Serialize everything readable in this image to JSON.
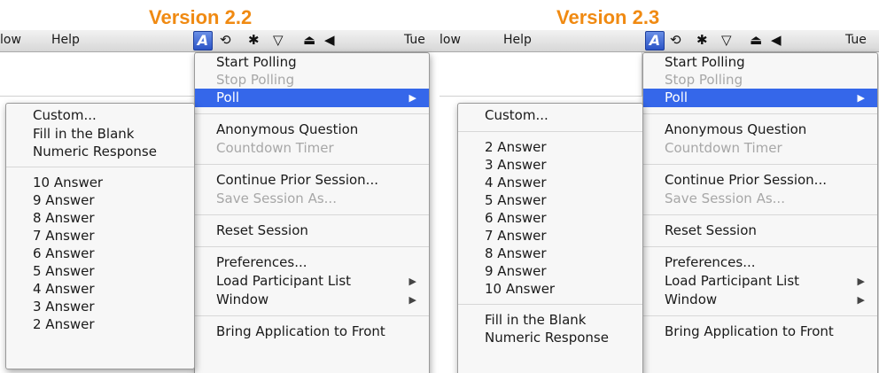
{
  "panels": [
    {
      "version_label": "Version 2.2",
      "menubar": {
        "window_fragment": "low",
        "help": "Help",
        "clock_fragment": "Tue",
        "app_icon_glyph": "A"
      },
      "status_icons": [
        "app-icon",
        "time-machine-icon",
        "bluetooth-icon",
        "wifi-icon",
        "eject-icon",
        "volume-icon"
      ],
      "main_menu": {
        "start_polling": "Start Polling",
        "stop_polling": "Stop Polling",
        "poll": "Poll",
        "anonymous_question": "Anonymous Question",
        "countdown_timer": "Countdown Timer",
        "continue_prior_session": "Continue Prior Session...",
        "save_session_as": "Save Session As...",
        "reset_session": "Reset Session",
        "preferences": "Preferences...",
        "load_participant_list": "Load Participant List",
        "window": "Window",
        "bring_to_front": "Bring Application to Front"
      },
      "submenu": {
        "custom": "Custom...",
        "fill_blank": "Fill in the Blank",
        "numeric_response": "Numeric Response",
        "answers": [
          "10 Answer",
          "9 Answer",
          "8 Answer",
          "7 Answer",
          "6 Answer",
          "5 Answer",
          "4 Answer",
          "3 Answer",
          "2 Answer"
        ]
      }
    },
    {
      "version_label": "Version 2.3",
      "menubar": {
        "window_fragment": "low",
        "help": "Help",
        "clock_fragment": "Tue",
        "app_icon_glyph": "A"
      },
      "status_icons": [
        "app-icon",
        "time-machine-icon",
        "bluetooth-icon",
        "wifi-icon",
        "eject-icon",
        "volume-icon"
      ],
      "main_menu": {
        "start_polling": "Start Polling",
        "stop_polling": "Stop Polling",
        "poll": "Poll",
        "anonymous_question": "Anonymous Question",
        "countdown_timer": "Countdown Timer",
        "continue_prior_session": "Continue Prior Session...",
        "save_session_as": "Save Session As...",
        "reset_session": "Reset Session",
        "preferences": "Preferences...",
        "load_participant_list": "Load Participant List",
        "window": "Window",
        "bring_to_front": "Bring Application to Front"
      },
      "submenu": {
        "custom": "Custom...",
        "answers": [
          "2 Answer",
          "3 Answer",
          "4 Answer",
          "5 Answer",
          "6 Answer",
          "7 Answer",
          "8 Answer",
          "9 Answer",
          "10 Answer"
        ],
        "fill_blank": "Fill in the Blank",
        "numeric_response": "Numeric Response"
      }
    }
  ],
  "colors": {
    "version_title": "#f08a12",
    "menu_highlight": "#3567ea",
    "disabled_text": "#a7a7a7"
  }
}
